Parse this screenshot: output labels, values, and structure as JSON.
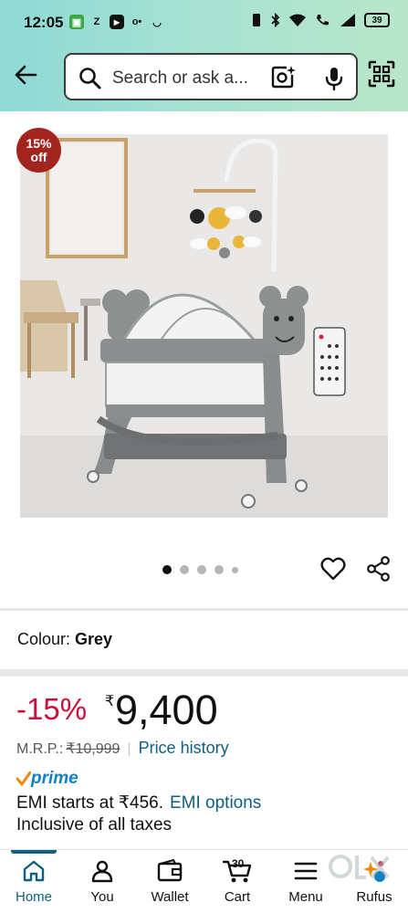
{
  "status_bar": {
    "time": "12:05",
    "notification_icons": [
      "app-icon",
      "z-icon",
      "youtube-icon",
      "app-icon",
      "amazon-icon"
    ],
    "battery": "39"
  },
  "header": {
    "search_placeholder": "Search or ask a..."
  },
  "product": {
    "badge_percent": "15%",
    "badge_suffix": "off",
    "image_count": 5,
    "active_image": 1
  },
  "colour": {
    "label": "Colour:",
    "value": "Grey"
  },
  "pricing": {
    "discount": "-15%",
    "currency": "₹",
    "price": "9,400",
    "mrp_label": "M.R.P.:",
    "mrp_value": "₹10,999",
    "history_link": "Price history"
  },
  "prime": {
    "label": "prime"
  },
  "emi": {
    "text": "EMI starts at ₹456.",
    "link": "EMI options",
    "taxes": "Inclusive of all taxes"
  },
  "bottom_nav": {
    "items": [
      {
        "label": "Home",
        "icon": "home-icon"
      },
      {
        "label": "You",
        "icon": "person-icon"
      },
      {
        "label": "Wallet",
        "icon": "wallet-icon"
      },
      {
        "label": "Cart",
        "icon": "cart-icon"
      },
      {
        "label": "Menu",
        "icon": "menu-icon"
      },
      {
        "label": "Rufus",
        "icon": "rufus-icon"
      }
    ],
    "cart_count": "30"
  },
  "colors": {
    "accent_link": "#0f5f7f",
    "discount_red": "#cc0c39",
    "badge_red": "#a3241d",
    "prime_blue": "#0f82c1"
  }
}
